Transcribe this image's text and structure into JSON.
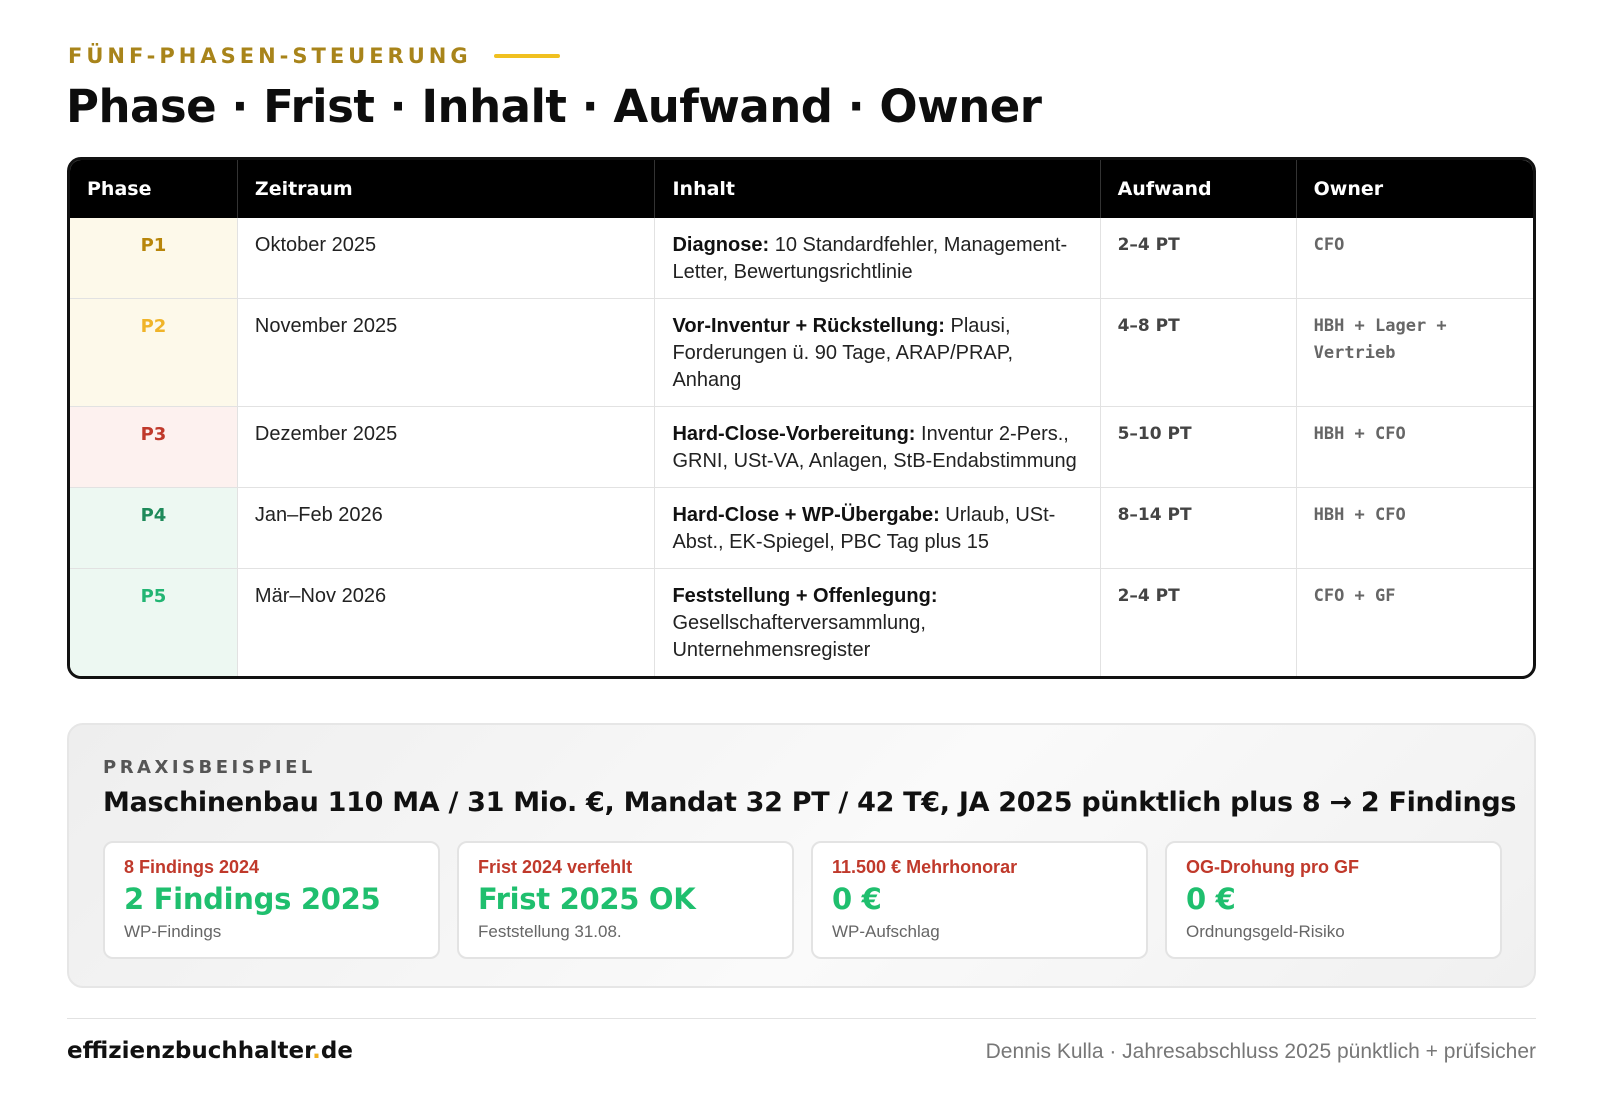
{
  "header": {
    "eyebrow": "FÜNF-PHASEN-STEUERUNG",
    "title": "Phase · Frist · Inhalt · Aufwand · Owner",
    "accent_color": "#a8841a",
    "accent_line_color": "#f0c020"
  },
  "table": {
    "columns": [
      "Phase",
      "Zeitraum",
      "Inhalt",
      "Aufwand",
      "Owner"
    ],
    "rows": [
      {
        "phase": "P1",
        "phase_color": "#b8860b",
        "phase_bg": "#fdf9ea",
        "zeitraum": "Oktober 2025",
        "inhalt_bold": "Diagnose:",
        "inhalt_rest": " 10 Standardfehler, Management-Letter, Bewertungsrichtlinie",
        "aufwand": "2–4 PT",
        "owner": "CFO"
      },
      {
        "phase": "P2",
        "phase_color": "#f0b429",
        "phase_bg": "#fdf9ea",
        "zeitraum": "November 2025",
        "inhalt_bold": "Vor-Inventur + Rückstellung:",
        "inhalt_rest": " Plausi, Forderungen ü. 90 Tage, ARAP/PRAP, Anhang",
        "aufwand": "4–8 PT",
        "owner": "HBH + Lager + Vertrieb"
      },
      {
        "phase": "P3",
        "phase_color": "#c0392b",
        "phase_bg": "#fdf1ef",
        "zeitraum": "Dezember 2025",
        "inhalt_bold": "Hard-Close-Vorbereitung:",
        "inhalt_rest": " Inventur 2-Pers., GRNI, USt-VA, Anlagen, StB-Endabstimmung",
        "aufwand": "5–10 PT",
        "owner": "HBH + CFO"
      },
      {
        "phase": "P4",
        "phase_color": "#1e8a5a",
        "phase_bg": "#edf8f2",
        "zeitraum": "Jan–Feb 2026",
        "inhalt_bold": "Hard-Close + WP-Übergabe:",
        "inhalt_rest": " Urlaub, USt-Abst., EK-Spiegel, PBC Tag plus 15",
        "aufwand": "8–14 PT",
        "owner": "HBH + CFO"
      },
      {
        "phase": "P5",
        "phase_color": "#22b573",
        "phase_bg": "#edf8f2",
        "zeitraum": "Mär–Nov 2026",
        "inhalt_bold": "Feststellung + Offenlegung:",
        "inhalt_rest": " Gesellschafterversammlung, Unternehmensregister",
        "aufwand": "2–4 PT",
        "owner": "CFO + GF"
      }
    ]
  },
  "praxis": {
    "eyebrow": "PRAXISBEISPIEL",
    "title": "Maschinenbau 110 MA / 31 Mio. €, Mandat 32 PT / 42 T€, JA 2025 pünktlich plus 8 → 2 Findings",
    "cards": [
      {
        "top": "8 Findings 2024",
        "main": "2 Findings 2025",
        "sub": "WP-Findings"
      },
      {
        "top": "Frist 2024 verfehlt",
        "main": "Frist 2025 OK",
        "sub": "Feststellung 31.08."
      },
      {
        "top": "11.500 € Mehrhonorar",
        "main": "0 €",
        "sub": "WP-Aufschlag"
      },
      {
        "top": "OG-Drohung pro GF",
        "main": "0 €",
        "sub": "Ordnungsgeld-Risiko"
      }
    ]
  },
  "footer": {
    "brand_name": "effizienzbuchhalter",
    "brand_dot": ".",
    "brand_tld": "de",
    "meta": "Dennis Kulla · Jahresabschluss 2025 pünktlich + prüfsicher"
  }
}
